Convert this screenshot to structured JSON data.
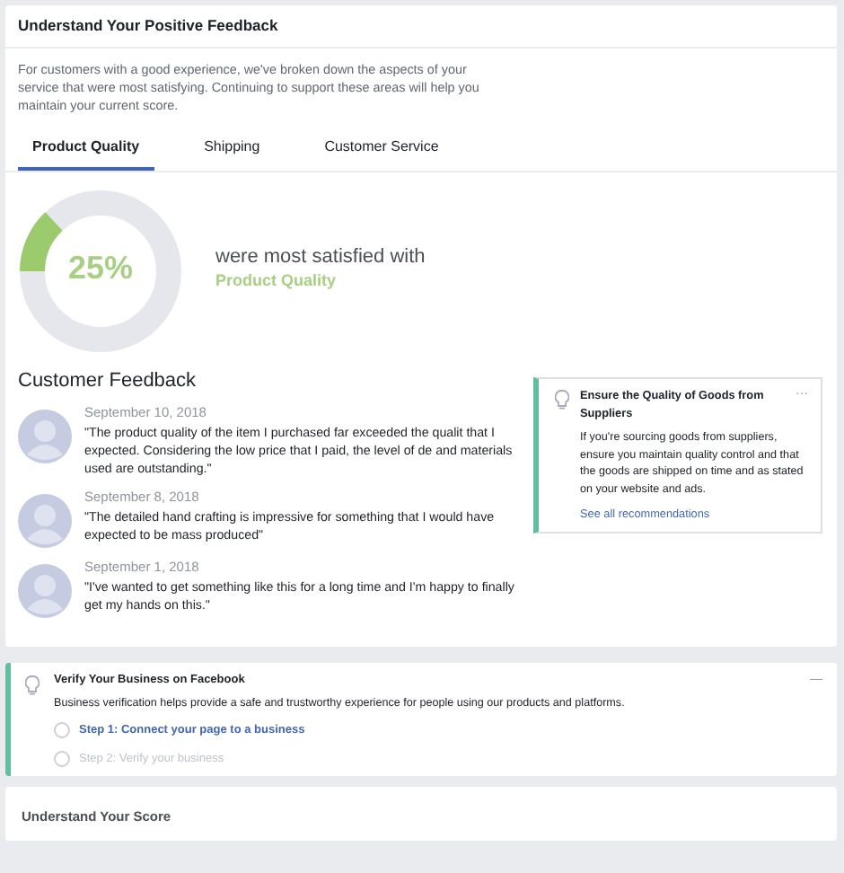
{
  "feedback_card": {
    "title": "Understand Your Positive Feedback",
    "description": "For customers with a good experience, we've broken down the aspects of your service that were most satisfying. Continuing to support these areas will help you maintain your current score.",
    "tabs": [
      {
        "label": "Product Quality",
        "selected": true
      },
      {
        "label": "Shipping",
        "selected": false
      },
      {
        "label": "Customer Service",
        "selected": false
      }
    ],
    "summary": {
      "percent": "25%",
      "level": 0.13,
      "caption": "were most satisfied with",
      "aspect": "Product Quality"
    },
    "customer_feedback": {
      "heading": "Customer Feedback",
      "reviews": [
        {
          "date": "September 10, 2018",
          "text": "\"The product quality of the item I purchased far exceeded the qualit that I expected. Considering the low price that I paid, the level of de and materials used are outstanding.\""
        },
        {
          "date": "September 8, 2018",
          "text": "\"The detailed hand crafting is impressive for something that I would have expected to be mass produced\""
        },
        {
          "date": "September 1, 2018",
          "text": "\"I've wanted to get something like this for a long time and I'm happy to finally get my hands on this.\""
        }
      ]
    },
    "recommendation": {
      "title": "Ensure the Quality of Goods from Suppliers",
      "menu": "···",
      "text": "If you're sourcing goods from suppliers, ensure you maintain quality control and that the goods are shipped on time and as stated on your website and ads.",
      "link": "See all recommendations"
    }
  },
  "verify_card": {
    "title": "Verify Your Business on Facebook",
    "menu": "—",
    "text": "Business verification helps provide a safe and trustworthy experience for people using our products and platforms.",
    "steps": [
      {
        "label": "Step 1: Connect your page to a business",
        "disabled": false
      },
      {
        "label": "Step 2: Verify your business",
        "disabled": true
      }
    ]
  },
  "score_card": {
    "title": "Understand Your Score"
  }
}
